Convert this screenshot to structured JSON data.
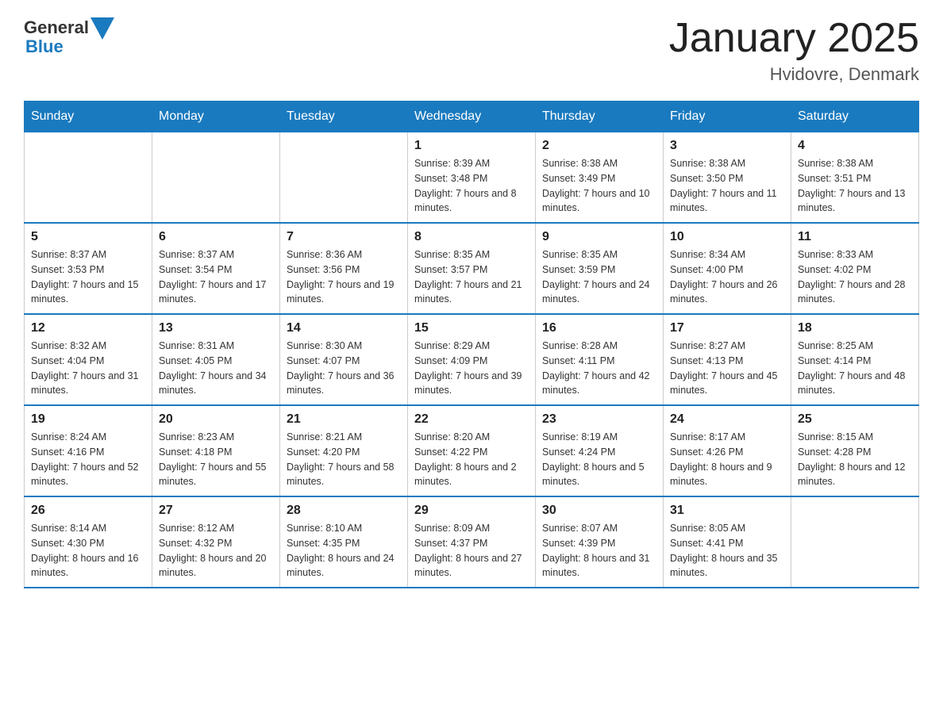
{
  "logo": {
    "text_general": "General",
    "text_blue": "Blue"
  },
  "title": "January 2025",
  "subtitle": "Hvidovre, Denmark",
  "days_of_week": [
    "Sunday",
    "Monday",
    "Tuesday",
    "Wednesday",
    "Thursday",
    "Friday",
    "Saturday"
  ],
  "weeks": [
    {
      "days": [
        {
          "number": "",
          "info": ""
        },
        {
          "number": "",
          "info": ""
        },
        {
          "number": "",
          "info": ""
        },
        {
          "number": "1",
          "info": "Sunrise: 8:39 AM\nSunset: 3:48 PM\nDaylight: 7 hours and 8 minutes."
        },
        {
          "number": "2",
          "info": "Sunrise: 8:38 AM\nSunset: 3:49 PM\nDaylight: 7 hours and 10 minutes."
        },
        {
          "number": "3",
          "info": "Sunrise: 8:38 AM\nSunset: 3:50 PM\nDaylight: 7 hours and 11 minutes."
        },
        {
          "number": "4",
          "info": "Sunrise: 8:38 AM\nSunset: 3:51 PM\nDaylight: 7 hours and 13 minutes."
        }
      ]
    },
    {
      "days": [
        {
          "number": "5",
          "info": "Sunrise: 8:37 AM\nSunset: 3:53 PM\nDaylight: 7 hours and 15 minutes."
        },
        {
          "number": "6",
          "info": "Sunrise: 8:37 AM\nSunset: 3:54 PM\nDaylight: 7 hours and 17 minutes."
        },
        {
          "number": "7",
          "info": "Sunrise: 8:36 AM\nSunset: 3:56 PM\nDaylight: 7 hours and 19 minutes."
        },
        {
          "number": "8",
          "info": "Sunrise: 8:35 AM\nSunset: 3:57 PM\nDaylight: 7 hours and 21 minutes."
        },
        {
          "number": "9",
          "info": "Sunrise: 8:35 AM\nSunset: 3:59 PM\nDaylight: 7 hours and 24 minutes."
        },
        {
          "number": "10",
          "info": "Sunrise: 8:34 AM\nSunset: 4:00 PM\nDaylight: 7 hours and 26 minutes."
        },
        {
          "number": "11",
          "info": "Sunrise: 8:33 AM\nSunset: 4:02 PM\nDaylight: 7 hours and 28 minutes."
        }
      ]
    },
    {
      "days": [
        {
          "number": "12",
          "info": "Sunrise: 8:32 AM\nSunset: 4:04 PM\nDaylight: 7 hours and 31 minutes."
        },
        {
          "number": "13",
          "info": "Sunrise: 8:31 AM\nSunset: 4:05 PM\nDaylight: 7 hours and 34 minutes."
        },
        {
          "number": "14",
          "info": "Sunrise: 8:30 AM\nSunset: 4:07 PM\nDaylight: 7 hours and 36 minutes."
        },
        {
          "number": "15",
          "info": "Sunrise: 8:29 AM\nSunset: 4:09 PM\nDaylight: 7 hours and 39 minutes."
        },
        {
          "number": "16",
          "info": "Sunrise: 8:28 AM\nSunset: 4:11 PM\nDaylight: 7 hours and 42 minutes."
        },
        {
          "number": "17",
          "info": "Sunrise: 8:27 AM\nSunset: 4:13 PM\nDaylight: 7 hours and 45 minutes."
        },
        {
          "number": "18",
          "info": "Sunrise: 8:25 AM\nSunset: 4:14 PM\nDaylight: 7 hours and 48 minutes."
        }
      ]
    },
    {
      "days": [
        {
          "number": "19",
          "info": "Sunrise: 8:24 AM\nSunset: 4:16 PM\nDaylight: 7 hours and 52 minutes."
        },
        {
          "number": "20",
          "info": "Sunrise: 8:23 AM\nSunset: 4:18 PM\nDaylight: 7 hours and 55 minutes."
        },
        {
          "number": "21",
          "info": "Sunrise: 8:21 AM\nSunset: 4:20 PM\nDaylight: 7 hours and 58 minutes."
        },
        {
          "number": "22",
          "info": "Sunrise: 8:20 AM\nSunset: 4:22 PM\nDaylight: 8 hours and 2 minutes."
        },
        {
          "number": "23",
          "info": "Sunrise: 8:19 AM\nSunset: 4:24 PM\nDaylight: 8 hours and 5 minutes."
        },
        {
          "number": "24",
          "info": "Sunrise: 8:17 AM\nSunset: 4:26 PM\nDaylight: 8 hours and 9 minutes."
        },
        {
          "number": "25",
          "info": "Sunrise: 8:15 AM\nSunset: 4:28 PM\nDaylight: 8 hours and 12 minutes."
        }
      ]
    },
    {
      "days": [
        {
          "number": "26",
          "info": "Sunrise: 8:14 AM\nSunset: 4:30 PM\nDaylight: 8 hours and 16 minutes."
        },
        {
          "number": "27",
          "info": "Sunrise: 8:12 AM\nSunset: 4:32 PM\nDaylight: 8 hours and 20 minutes."
        },
        {
          "number": "28",
          "info": "Sunrise: 8:10 AM\nSunset: 4:35 PM\nDaylight: 8 hours and 24 minutes."
        },
        {
          "number": "29",
          "info": "Sunrise: 8:09 AM\nSunset: 4:37 PM\nDaylight: 8 hours and 27 minutes."
        },
        {
          "number": "30",
          "info": "Sunrise: 8:07 AM\nSunset: 4:39 PM\nDaylight: 8 hours and 31 minutes."
        },
        {
          "number": "31",
          "info": "Sunrise: 8:05 AM\nSunset: 4:41 PM\nDaylight: 8 hours and 35 minutes."
        },
        {
          "number": "",
          "info": ""
        }
      ]
    }
  ]
}
